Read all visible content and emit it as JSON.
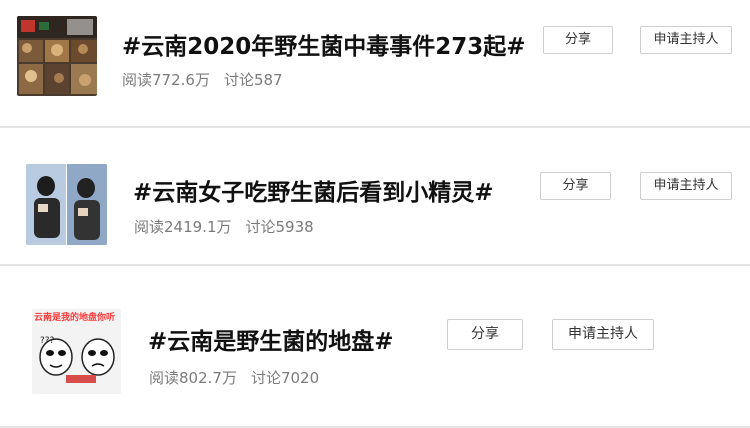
{
  "topics": [
    {
      "title": "#云南2020年野生菌中毒事件273起#",
      "reads": "阅读772.6万",
      "discussions": "讨论587",
      "share_label": "分享",
      "host_label": "申请主持人"
    },
    {
      "title": "#云南女子吃野生菌后看到小精灵#",
      "reads": "阅读2419.1万",
      "discussions": "讨论5938",
      "share_label": "分享",
      "host_label": "申请主持人"
    },
    {
      "title": "#云南是野生菌的地盘#",
      "reads": "阅读802.7万",
      "discussions": "讨论7020",
      "share_label": "分享",
      "host_label": "申请主持人"
    }
  ],
  "meme": {
    "top_text": "云南是我的地盘你听"
  }
}
